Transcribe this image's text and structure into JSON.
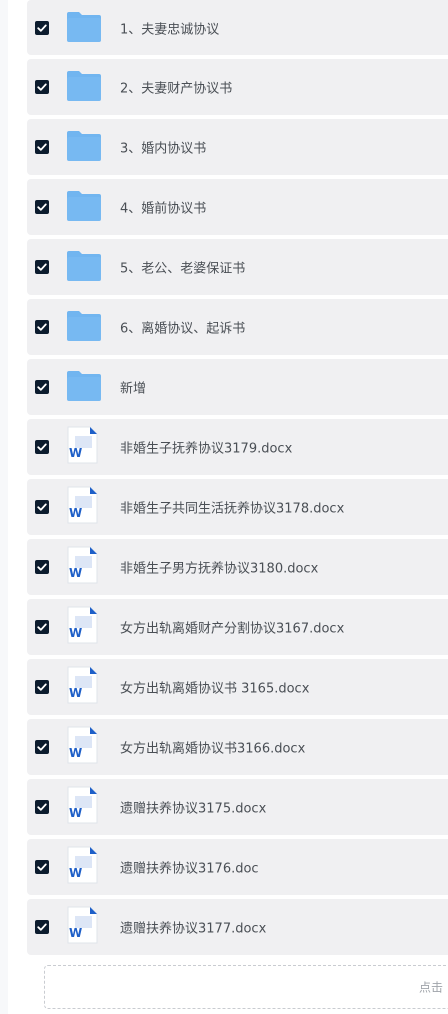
{
  "colors": {
    "checkbox": "#0c1c2e",
    "folder": "#5aaaf0",
    "word_icon": "#1e5fc8"
  },
  "files": [
    {
      "type": "folder",
      "icon": "folder-icon",
      "checked": true,
      "name": "1、夫妻忠诚协议"
    },
    {
      "type": "folder",
      "icon": "folder-icon",
      "checked": true,
      "name": "2、夫妻财产协议书"
    },
    {
      "type": "folder",
      "icon": "folder-icon",
      "checked": true,
      "name": "3、婚内协议书"
    },
    {
      "type": "folder",
      "icon": "folder-icon",
      "checked": true,
      "name": "4、婚前协议书"
    },
    {
      "type": "folder",
      "icon": "folder-icon",
      "checked": true,
      "name": "5、老公、老婆保证书"
    },
    {
      "type": "folder",
      "icon": "folder-icon",
      "checked": true,
      "name": "6、离婚协议、起诉书"
    },
    {
      "type": "folder",
      "icon": "folder-icon",
      "checked": true,
      "name": "新增"
    },
    {
      "type": "word",
      "icon": "word-doc-icon",
      "checked": true,
      "name": "非婚生子抚养协议3179.docx"
    },
    {
      "type": "word",
      "icon": "word-doc-icon",
      "checked": true,
      "name": "非婚生子共同生活抚养协议3178.docx"
    },
    {
      "type": "word",
      "icon": "word-doc-icon",
      "checked": true,
      "name": "非婚生子男方抚养协议3180.docx"
    },
    {
      "type": "word",
      "icon": "word-doc-icon",
      "checked": true,
      "name": "女方出轨离婚财产分割协议3167.docx"
    },
    {
      "type": "word",
      "icon": "word-doc-icon",
      "checked": true,
      "name": "女方出轨离婚协议书 3165.docx"
    },
    {
      "type": "word",
      "icon": "word-doc-icon",
      "checked": true,
      "name": "女方出轨离婚协议书3166.docx"
    },
    {
      "type": "word",
      "icon": "word-doc-icon",
      "checked": true,
      "name": "遗赠扶养协议3175.docx"
    },
    {
      "type": "word",
      "icon": "word-doc-icon",
      "checked": true,
      "name": "遗赠扶养协议3176.doc"
    },
    {
      "type": "word",
      "icon": "word-doc-icon",
      "checked": true,
      "name": "遗赠扶养协议3177.docx"
    }
  ],
  "upload": {
    "hint": "点击"
  }
}
